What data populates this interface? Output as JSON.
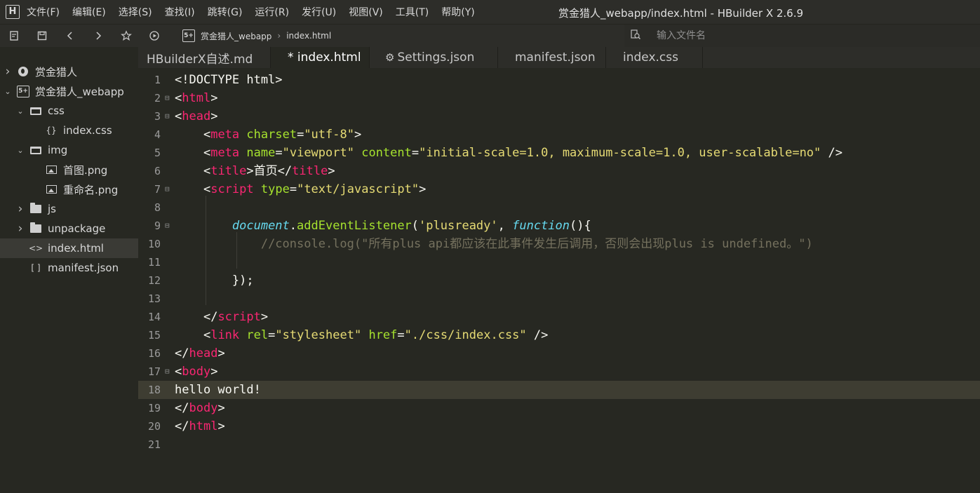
{
  "window": {
    "title": "赏金猎人_webapp/index.html - HBuilder X 2.6.9"
  },
  "menu": [
    "文件(F)",
    "编辑(E)",
    "选择(S)",
    "查找(I)",
    "跳转(G)",
    "运行(R)",
    "发行(U)",
    "视图(V)",
    "工具(T)",
    "帮助(Y)"
  ],
  "toolbar": {
    "breadcrumb": [
      "赏金猎人_webapp",
      "index.html"
    ],
    "search_placeholder": "输入文件名"
  },
  "sidebar": {
    "items": [
      {
        "label": "赏金猎人",
        "chevron": "right",
        "icon": "globe-icon",
        "depth": 0
      },
      {
        "label": "赏金猎人_webapp",
        "chevron": "down",
        "icon": "s5-project-icon",
        "depth": 0
      },
      {
        "label": "css",
        "chevron": "down",
        "icon": "folder-open-icon",
        "depth": 1
      },
      {
        "label": "index.css",
        "chevron": "",
        "icon": "css-file-icon",
        "icon_text": "{}",
        "depth": 2
      },
      {
        "label": "img",
        "chevron": "down",
        "icon": "folder-open-icon",
        "depth": 1
      },
      {
        "label": "首图.png",
        "chevron": "",
        "icon": "image-file-icon",
        "depth": 2
      },
      {
        "label": "重命名.png",
        "chevron": "",
        "icon": "image-file-icon",
        "depth": 2
      },
      {
        "label": "js",
        "chevron": "right",
        "icon": "folder-icon",
        "depth": 1
      },
      {
        "label": "unpackage",
        "chevron": "right",
        "icon": "folder-icon",
        "depth": 1
      },
      {
        "label": "index.html",
        "chevron": "",
        "icon": "html-file-icon",
        "icon_text": "<>",
        "depth": 1,
        "selected": true
      },
      {
        "label": "manifest.json",
        "chevron": "",
        "icon": "json-file-icon",
        "icon_text": "[ ]",
        "depth": 1
      }
    ]
  },
  "tabs": [
    {
      "label": "HBuilderX自述.md",
      "active": false,
      "gear": false
    },
    {
      "label": "* index.html",
      "active": true,
      "gear": false
    },
    {
      "label": "Settings.json",
      "active": false,
      "gear": true
    },
    {
      "label": "manifest.json",
      "active": false,
      "gear": false
    },
    {
      "label": "index.css",
      "active": false,
      "gear": false
    }
  ],
  "editor": {
    "current_line": 18,
    "lines": [
      {
        "n": "1",
        "fold": false,
        "tokens": [
          [
            "punc",
            "<!DOCTYPE html>"
          ]
        ]
      },
      {
        "n": "2",
        "fold": true,
        "tokens": [
          [
            "punc",
            "<"
          ],
          [
            "tag",
            "html"
          ],
          [
            "punc",
            ">"
          ]
        ]
      },
      {
        "n": "3",
        "fold": true,
        "tokens": [
          [
            "punc",
            "<"
          ],
          [
            "tag",
            "head"
          ],
          [
            "punc",
            ">"
          ]
        ]
      },
      {
        "n": "4",
        "fold": false,
        "tokens": [
          [
            "text",
            "    "
          ],
          [
            "punc",
            "<"
          ],
          [
            "tag",
            "meta"
          ],
          [
            "text",
            " "
          ],
          [
            "attr",
            "charset"
          ],
          [
            "punc",
            "="
          ],
          [
            "str",
            "\"utf-8\""
          ],
          [
            "punc",
            ">"
          ]
        ]
      },
      {
        "n": "5",
        "fold": false,
        "tokens": [
          [
            "text",
            "    "
          ],
          [
            "punc",
            "<"
          ],
          [
            "tag",
            "meta"
          ],
          [
            "text",
            " "
          ],
          [
            "attr",
            "name"
          ],
          [
            "punc",
            "="
          ],
          [
            "str",
            "\"viewport\""
          ],
          [
            "text",
            " "
          ],
          [
            "attr",
            "content"
          ],
          [
            "punc",
            "="
          ],
          [
            "str",
            "\"initial-scale=1.0, maximum-scale=1.0, user-scalable=no\""
          ],
          [
            "text",
            " "
          ],
          [
            "punc",
            "/>"
          ]
        ]
      },
      {
        "n": "6",
        "fold": false,
        "tokens": [
          [
            "text",
            "    "
          ],
          [
            "punc",
            "<"
          ],
          [
            "tag",
            "title"
          ],
          [
            "punc",
            ">"
          ],
          [
            "text",
            "首页"
          ],
          [
            "punc",
            "</"
          ],
          [
            "tag",
            "title"
          ],
          [
            "punc",
            ">"
          ]
        ]
      },
      {
        "n": "7",
        "fold": true,
        "tokens": [
          [
            "text",
            "    "
          ],
          [
            "punc",
            "<"
          ],
          [
            "tag",
            "script"
          ],
          [
            "text",
            " "
          ],
          [
            "attr",
            "type"
          ],
          [
            "punc",
            "="
          ],
          [
            "str",
            "\"text/javascript\""
          ],
          [
            "punc",
            ">"
          ]
        ]
      },
      {
        "n": "8",
        "fold": false,
        "tokens": []
      },
      {
        "n": "9",
        "fold": true,
        "tokens": [
          [
            "text",
            "        "
          ],
          [
            "obj",
            "document"
          ],
          [
            "punc",
            "."
          ],
          [
            "func",
            "addEventListener"
          ],
          [
            "punc",
            "("
          ],
          [
            "str",
            "'plusready'"
          ],
          [
            "punc",
            ", "
          ],
          [
            "kw",
            "function"
          ],
          [
            "punc",
            "(){"
          ]
        ]
      },
      {
        "n": "10",
        "fold": false,
        "tokens": [
          [
            "text",
            "            "
          ],
          [
            "comment",
            "//console.log(\"所有plus api都应该在此事件发生后调用，否则会出现plus is undefined。\")"
          ]
        ]
      },
      {
        "n": "11",
        "fold": false,
        "tokens": []
      },
      {
        "n": "12",
        "fold": false,
        "tokens": [
          [
            "text",
            "        "
          ],
          [
            "punc",
            "});"
          ]
        ]
      },
      {
        "n": "13",
        "fold": false,
        "tokens": []
      },
      {
        "n": "14",
        "fold": false,
        "tokens": [
          [
            "text",
            "    "
          ],
          [
            "punc",
            "</"
          ],
          [
            "tag",
            "script"
          ],
          [
            "punc",
            ">"
          ]
        ]
      },
      {
        "n": "15",
        "fold": false,
        "tokens": [
          [
            "text",
            "    "
          ],
          [
            "punc",
            "<"
          ],
          [
            "tag",
            "link"
          ],
          [
            "text",
            " "
          ],
          [
            "attr",
            "rel"
          ],
          [
            "punc",
            "="
          ],
          [
            "str",
            "\"stylesheet\""
          ],
          [
            "text",
            " "
          ],
          [
            "attr",
            "href"
          ],
          [
            "punc",
            "="
          ],
          [
            "str",
            "\"./css/index.css\""
          ],
          [
            "text",
            " "
          ],
          [
            "punc",
            "/>"
          ]
        ]
      },
      {
        "n": "16",
        "fold": false,
        "tokens": [
          [
            "punc",
            "</"
          ],
          [
            "tag",
            "head"
          ],
          [
            "punc",
            ">"
          ]
        ]
      },
      {
        "n": "17",
        "fold": true,
        "tokens": [
          [
            "punc",
            "<"
          ],
          [
            "tag",
            "body"
          ],
          [
            "punc",
            ">"
          ]
        ]
      },
      {
        "n": "18",
        "fold": false,
        "tokens": [
          [
            "text",
            "hello world!"
          ]
        ]
      },
      {
        "n": "19",
        "fold": false,
        "tokens": [
          [
            "punc",
            "</"
          ],
          [
            "tag",
            "body"
          ],
          [
            "punc",
            ">"
          ]
        ]
      },
      {
        "n": "20",
        "fold": false,
        "tokens": [
          [
            "punc",
            "</"
          ],
          [
            "tag",
            "html"
          ],
          [
            "punc",
            ">"
          ]
        ]
      },
      {
        "n": "21",
        "fold": false,
        "tokens": []
      }
    ]
  },
  "colors": {
    "background": "#272822",
    "tag": "#f92672",
    "attribute": "#a6e22e",
    "string": "#e6db74",
    "comment": "#75715e",
    "object": "#66d9ef"
  }
}
